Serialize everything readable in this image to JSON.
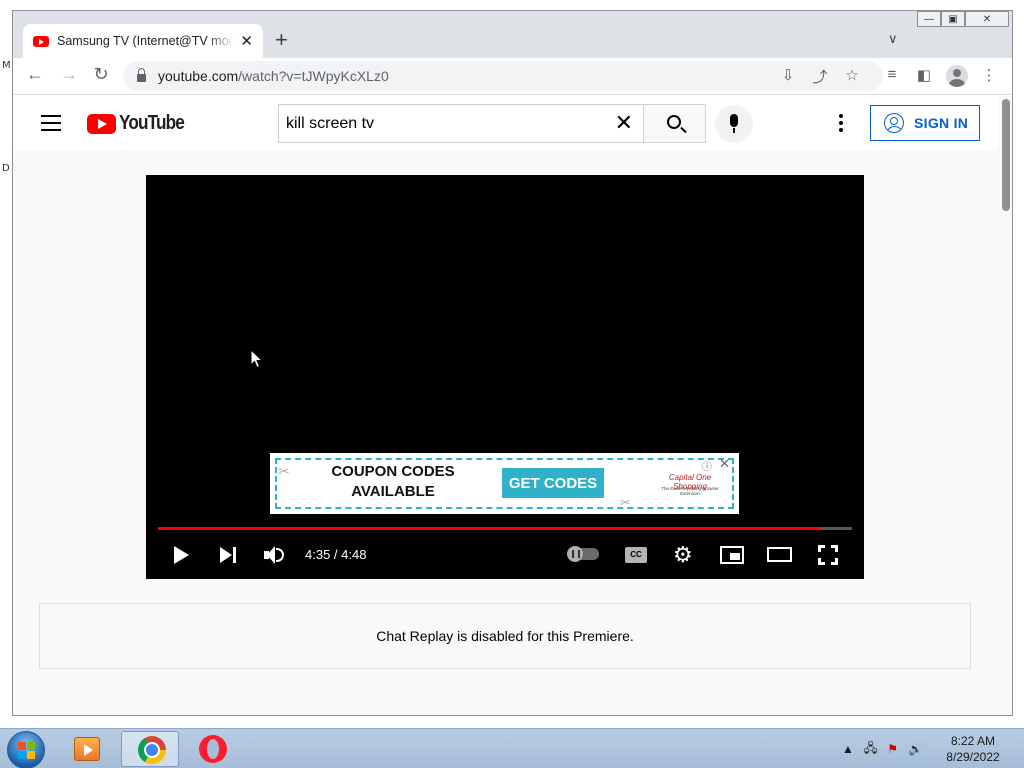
{
  "browser": {
    "tab_title": "Samsung TV (Internet@TV mode",
    "tab_close": "✕",
    "new_tab": "+",
    "url_host": "youtube.com",
    "url_path": "/watch?v=tJWpyKcXLz0"
  },
  "youtube": {
    "logo_text": "YouTube",
    "search_value": "kill screen tv",
    "search_clear": "✕",
    "sign_in_label": "SIGN IN"
  },
  "player": {
    "progress_fraction": 0.955,
    "time_display": "4:35 / 4:48",
    "cc_label": "CC",
    "ad": {
      "headline_line1": "COUPON CODES",
      "headline_line2": "AVAILABLE",
      "cta": "GET CODES",
      "brand": "Capital One Shopping",
      "brand_sub": "The Easiest Finding Browser Extension"
    }
  },
  "chat_replay_message": "Chat Replay is disabled for this Premiere.",
  "taskbar": {
    "clock_time": "8:22 AM",
    "clock_date": "8/29/2022"
  },
  "desktop": {
    "left_letters": [
      "M",
      "D"
    ]
  },
  "colors": {
    "youtube_red": "#ff0000",
    "signin_blue": "#065fd4",
    "ad_accent": "#2eb1c9"
  }
}
